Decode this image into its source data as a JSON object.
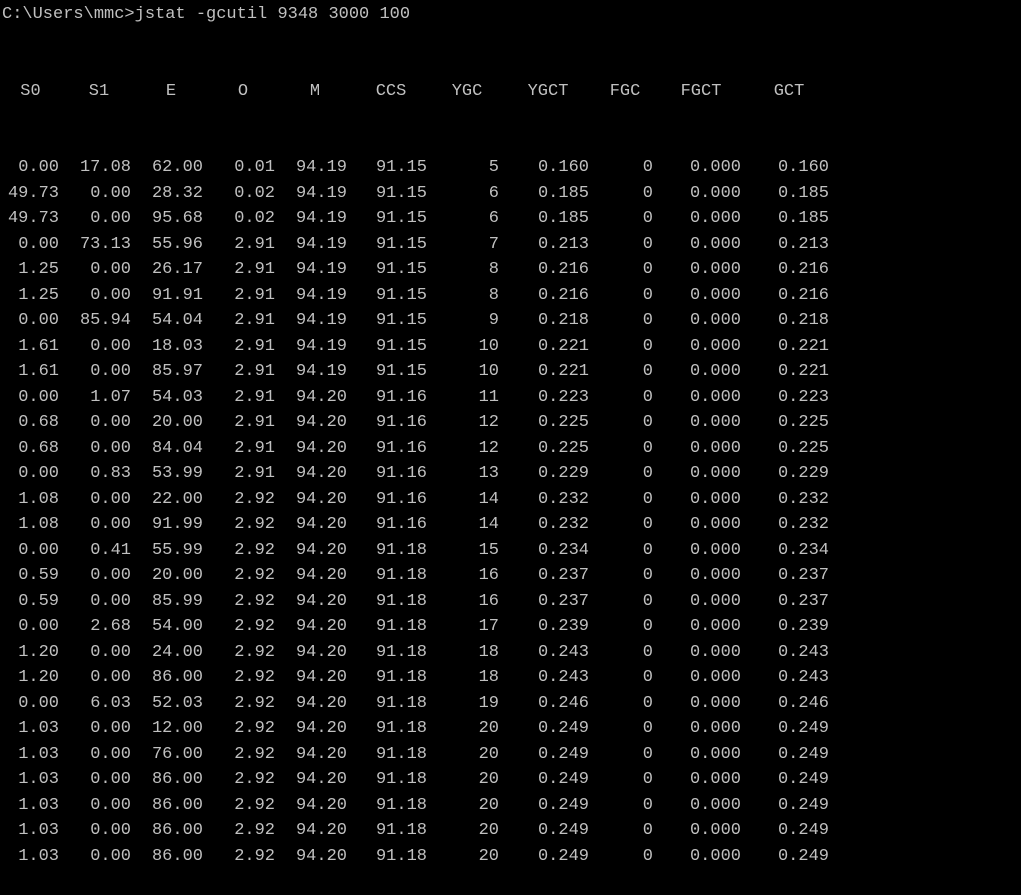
{
  "prompt": "C:\\Users\\mmc>jstat -gcutil 9348 3000 100",
  "headers": {
    "s0": "S0",
    "s1": "S1",
    "e": "E",
    "o": "O",
    "m": "M",
    "ccs": "CCS",
    "ygc": "YGC",
    "ygct": "YGCT",
    "fgc": "FGC",
    "fgct": "FGCT",
    "gct": "GCT"
  },
  "rows": [
    {
      "s0": "0.00",
      "s1": "17.08",
      "e": "62.00",
      "o": "0.01",
      "m": "94.19",
      "ccs": "91.15",
      "ygc": "5",
      "ygct": "0.160",
      "fgc": "0",
      "fgct": "0.000",
      "gct": "0.160"
    },
    {
      "s0": "49.73",
      "s1": "0.00",
      "e": "28.32",
      "o": "0.02",
      "m": "94.19",
      "ccs": "91.15",
      "ygc": "6",
      "ygct": "0.185",
      "fgc": "0",
      "fgct": "0.000",
      "gct": "0.185"
    },
    {
      "s0": "49.73",
      "s1": "0.00",
      "e": "95.68",
      "o": "0.02",
      "m": "94.19",
      "ccs": "91.15",
      "ygc": "6",
      "ygct": "0.185",
      "fgc": "0",
      "fgct": "0.000",
      "gct": "0.185"
    },
    {
      "s0": "0.00",
      "s1": "73.13",
      "e": "55.96",
      "o": "2.91",
      "m": "94.19",
      "ccs": "91.15",
      "ygc": "7",
      "ygct": "0.213",
      "fgc": "0",
      "fgct": "0.000",
      "gct": "0.213"
    },
    {
      "s0": "1.25",
      "s1": "0.00",
      "e": "26.17",
      "o": "2.91",
      "m": "94.19",
      "ccs": "91.15",
      "ygc": "8",
      "ygct": "0.216",
      "fgc": "0",
      "fgct": "0.000",
      "gct": "0.216"
    },
    {
      "s0": "1.25",
      "s1": "0.00",
      "e": "91.91",
      "o": "2.91",
      "m": "94.19",
      "ccs": "91.15",
      "ygc": "8",
      "ygct": "0.216",
      "fgc": "0",
      "fgct": "0.000",
      "gct": "0.216"
    },
    {
      "s0": "0.00",
      "s1": "85.94",
      "e": "54.04",
      "o": "2.91",
      "m": "94.19",
      "ccs": "91.15",
      "ygc": "9",
      "ygct": "0.218",
      "fgc": "0",
      "fgct": "0.000",
      "gct": "0.218"
    },
    {
      "s0": "1.61",
      "s1": "0.00",
      "e": "18.03",
      "o": "2.91",
      "m": "94.19",
      "ccs": "91.15",
      "ygc": "10",
      "ygct": "0.221",
      "fgc": "0",
      "fgct": "0.000",
      "gct": "0.221"
    },
    {
      "s0": "1.61",
      "s1": "0.00",
      "e": "85.97",
      "o": "2.91",
      "m": "94.19",
      "ccs": "91.15",
      "ygc": "10",
      "ygct": "0.221",
      "fgc": "0",
      "fgct": "0.000",
      "gct": "0.221"
    },
    {
      "s0": "0.00",
      "s1": "1.07",
      "e": "54.03",
      "o": "2.91",
      "m": "94.20",
      "ccs": "91.16",
      "ygc": "11",
      "ygct": "0.223",
      "fgc": "0",
      "fgct": "0.000",
      "gct": "0.223"
    },
    {
      "s0": "0.68",
      "s1": "0.00",
      "e": "20.00",
      "o": "2.91",
      "m": "94.20",
      "ccs": "91.16",
      "ygc": "12",
      "ygct": "0.225",
      "fgc": "0",
      "fgct": "0.000",
      "gct": "0.225"
    },
    {
      "s0": "0.68",
      "s1": "0.00",
      "e": "84.04",
      "o": "2.91",
      "m": "94.20",
      "ccs": "91.16",
      "ygc": "12",
      "ygct": "0.225",
      "fgc": "0",
      "fgct": "0.000",
      "gct": "0.225"
    },
    {
      "s0": "0.00",
      "s1": "0.83",
      "e": "53.99",
      "o": "2.91",
      "m": "94.20",
      "ccs": "91.16",
      "ygc": "13",
      "ygct": "0.229",
      "fgc": "0",
      "fgct": "0.000",
      "gct": "0.229"
    },
    {
      "s0": "1.08",
      "s1": "0.00",
      "e": "22.00",
      "o": "2.92",
      "m": "94.20",
      "ccs": "91.16",
      "ygc": "14",
      "ygct": "0.232",
      "fgc": "0",
      "fgct": "0.000",
      "gct": "0.232"
    },
    {
      "s0": "1.08",
      "s1": "0.00",
      "e": "91.99",
      "o": "2.92",
      "m": "94.20",
      "ccs": "91.16",
      "ygc": "14",
      "ygct": "0.232",
      "fgc": "0",
      "fgct": "0.000",
      "gct": "0.232"
    },
    {
      "s0": "0.00",
      "s1": "0.41",
      "e": "55.99",
      "o": "2.92",
      "m": "94.20",
      "ccs": "91.18",
      "ygc": "15",
      "ygct": "0.234",
      "fgc": "0",
      "fgct": "0.000",
      "gct": "0.234"
    },
    {
      "s0": "0.59",
      "s1": "0.00",
      "e": "20.00",
      "o": "2.92",
      "m": "94.20",
      "ccs": "91.18",
      "ygc": "16",
      "ygct": "0.237",
      "fgc": "0",
      "fgct": "0.000",
      "gct": "0.237"
    },
    {
      "s0": "0.59",
      "s1": "0.00",
      "e": "85.99",
      "o": "2.92",
      "m": "94.20",
      "ccs": "91.18",
      "ygc": "16",
      "ygct": "0.237",
      "fgc": "0",
      "fgct": "0.000",
      "gct": "0.237"
    },
    {
      "s0": "0.00",
      "s1": "2.68",
      "e": "54.00",
      "o": "2.92",
      "m": "94.20",
      "ccs": "91.18",
      "ygc": "17",
      "ygct": "0.239",
      "fgc": "0",
      "fgct": "0.000",
      "gct": "0.239"
    },
    {
      "s0": "1.20",
      "s1": "0.00",
      "e": "24.00",
      "o": "2.92",
      "m": "94.20",
      "ccs": "91.18",
      "ygc": "18",
      "ygct": "0.243",
      "fgc": "0",
      "fgct": "0.000",
      "gct": "0.243"
    },
    {
      "s0": "1.20",
      "s1": "0.00",
      "e": "86.00",
      "o": "2.92",
      "m": "94.20",
      "ccs": "91.18",
      "ygc": "18",
      "ygct": "0.243",
      "fgc": "0",
      "fgct": "0.000",
      "gct": "0.243"
    },
    {
      "s0": "0.00",
      "s1": "6.03",
      "e": "52.03",
      "o": "2.92",
      "m": "94.20",
      "ccs": "91.18",
      "ygc": "19",
      "ygct": "0.246",
      "fgc": "0",
      "fgct": "0.000",
      "gct": "0.246"
    },
    {
      "s0": "1.03",
      "s1": "0.00",
      "e": "12.00",
      "o": "2.92",
      "m": "94.20",
      "ccs": "91.18",
      "ygc": "20",
      "ygct": "0.249",
      "fgc": "0",
      "fgct": "0.000",
      "gct": "0.249"
    },
    {
      "s0": "1.03",
      "s1": "0.00",
      "e": "76.00",
      "o": "2.92",
      "m": "94.20",
      "ccs": "91.18",
      "ygc": "20",
      "ygct": "0.249",
      "fgc": "0",
      "fgct": "0.000",
      "gct": "0.249"
    },
    {
      "s0": "1.03",
      "s1": "0.00",
      "e": "86.00",
      "o": "2.92",
      "m": "94.20",
      "ccs": "91.18",
      "ygc": "20",
      "ygct": "0.249",
      "fgc": "0",
      "fgct": "0.000",
      "gct": "0.249"
    },
    {
      "s0": "1.03",
      "s1": "0.00",
      "e": "86.00",
      "o": "2.92",
      "m": "94.20",
      "ccs": "91.18",
      "ygc": "20",
      "ygct": "0.249",
      "fgc": "0",
      "fgct": "0.000",
      "gct": "0.249"
    },
    {
      "s0": "1.03",
      "s1": "0.00",
      "e": "86.00",
      "o": "2.92",
      "m": "94.20",
      "ccs": "91.18",
      "ygc": "20",
      "ygct": "0.249",
      "fgc": "0",
      "fgct": "0.000",
      "gct": "0.249"
    },
    {
      "s0": "1.03",
      "s1": "0.00",
      "e": "86.00",
      "o": "2.92",
      "m": "94.20",
      "ccs": "91.18",
      "ygc": "20",
      "ygct": "0.249",
      "fgc": "0",
      "fgct": "0.000",
      "gct": "0.249"
    }
  ]
}
